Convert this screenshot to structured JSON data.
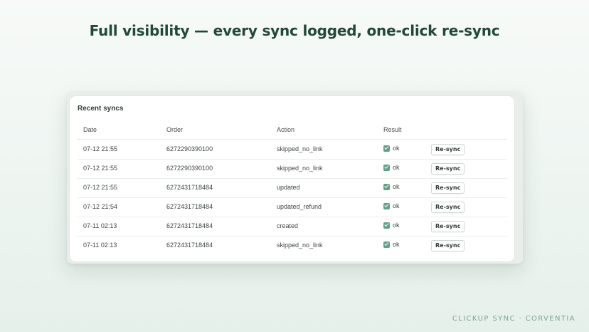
{
  "headline": "Full visibility — every sync logged, one-click re-sync",
  "panel": {
    "title": "Recent syncs",
    "columns": {
      "date": "Date",
      "order": "Order",
      "action": "Action",
      "result": "Result"
    },
    "rows": [
      {
        "date": "07-12 21:55",
        "order": "6272290390100",
        "action": "skipped_no_link",
        "result": "ok",
        "button": "Re-sync"
      },
      {
        "date": "07-12 21:55",
        "order": "6272290390100",
        "action": "skipped_no_link",
        "result": "ok",
        "button": "Re-sync"
      },
      {
        "date": "07-12 21:55",
        "order": "6272431718484",
        "action": "updated",
        "result": "ok",
        "button": "Re-sync"
      },
      {
        "date": "07-12 21:54",
        "order": "6272431718484",
        "action": "updated_refund",
        "result": "ok",
        "button": "Re-sync"
      },
      {
        "date": "07-11 02:13",
        "order": "6272431718484",
        "action": "created",
        "result": "ok",
        "button": "Re-sync"
      },
      {
        "date": "07-11 02:13",
        "order": "6272431718484",
        "action": "skipped_no_link",
        "result": "ok",
        "button": "Re-sync"
      }
    ]
  },
  "brand": "CLICKUP SYNC · CORVENTIA",
  "colors": {
    "headline": "#1f4a3a",
    "accent": "#5fa287",
    "brand": "#7aa693"
  },
  "icons": {
    "result_ok": "checkbox-checked-icon"
  }
}
